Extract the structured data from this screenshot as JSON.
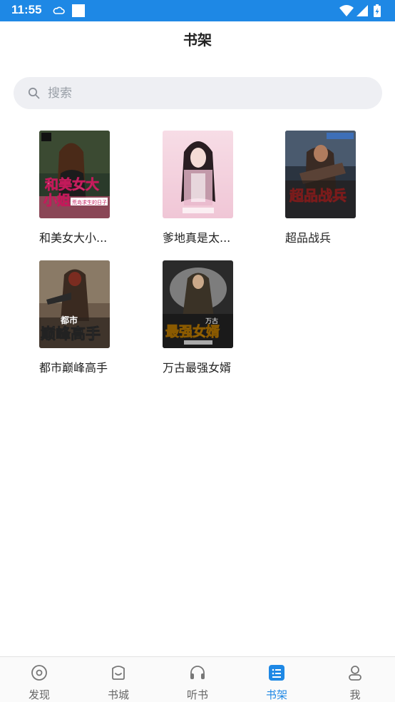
{
  "status_bar": {
    "time": "11:55",
    "icons": [
      "cloud-sync-icon",
      "notification-square-icon",
      "wifi-icon",
      "signal-icon",
      "battery-charging-icon"
    ],
    "color": "#1e88e5"
  },
  "header": {
    "title": "书架"
  },
  "search": {
    "placeholder": "搜索"
  },
  "books": [
    {
      "title": "和美女大小...",
      "cover_text": "和美女大小姐",
      "cover_subtitle": "荒岛求生的日子"
    },
    {
      "title": "爹地真是太...",
      "cover_text": ""
    },
    {
      "title": "超品战兵",
      "cover_text": "超品战兵"
    },
    {
      "title": "都市巅峰高手",
      "cover_text": "都市巅峰高手"
    },
    {
      "title": "万古最强女婿",
      "cover_text": "最强女婿"
    }
  ],
  "bottom_nav": {
    "items": [
      {
        "label": "发现",
        "icon": "compass-icon"
      },
      {
        "label": "书城",
        "icon": "store-icon"
      },
      {
        "label": "听书",
        "icon": "headphones-icon"
      },
      {
        "label": "书架",
        "icon": "bookshelf-icon",
        "active": true
      },
      {
        "label": "我",
        "icon": "user-icon"
      }
    ],
    "active_color": "#1e88e5"
  }
}
